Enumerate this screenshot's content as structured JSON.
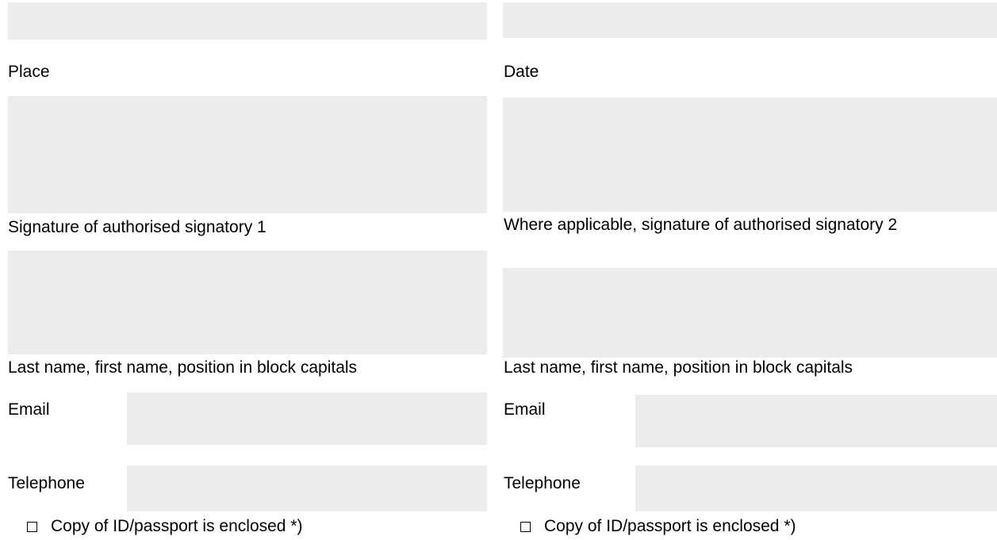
{
  "left": {
    "place_label": "Place",
    "signature_label": "Signature of authorised signatory 1",
    "name_label": "Last name, first name, position in block capitals",
    "email_label": "Email",
    "telephone_label": "Telephone",
    "id_check_label": "Copy of ID/passport is enclosed *)",
    "id_checked": false
  },
  "right": {
    "date_label": "Date",
    "signature_label": "Where applicable, signature of authorised signatory 2",
    "name_label": "Last name, first name, position in block capitals",
    "email_label": "Email",
    "telephone_label": "Telephone",
    "id_check_label": "Copy of ID/passport is enclosed *)",
    "id_checked": false
  }
}
